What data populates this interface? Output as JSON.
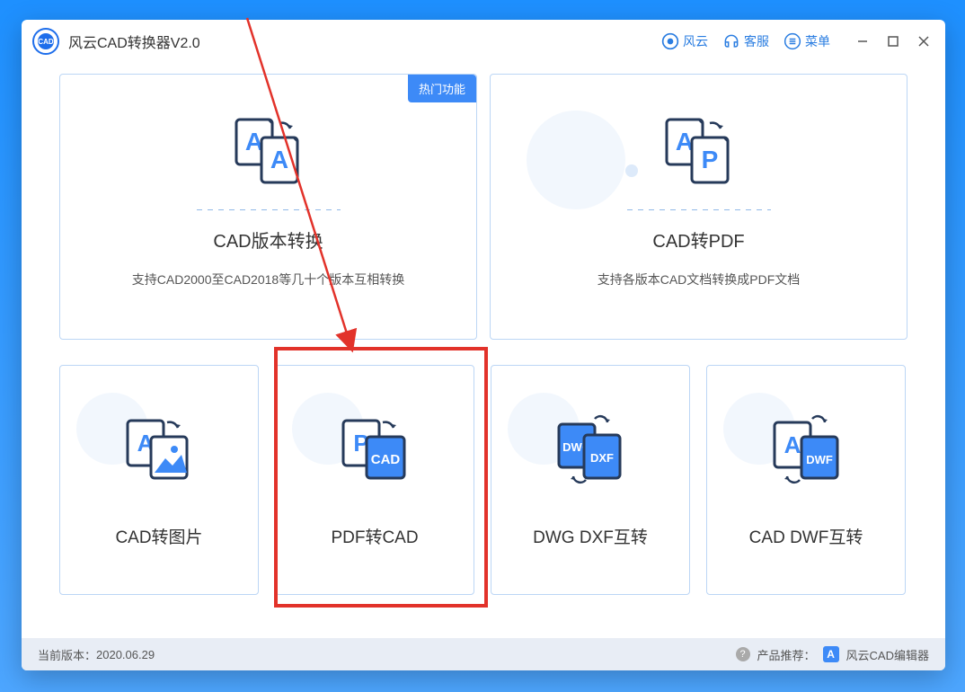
{
  "app": {
    "title": "风云CAD转换器V2.0",
    "logo_text": "CAD"
  },
  "titlebar": {
    "fengyun": "风云",
    "kefu": "客服",
    "menu": "菜单"
  },
  "cards": {
    "cad_version": {
      "badge": "热门功能",
      "title": "CAD版本转换",
      "desc": "支持CAD2000至CAD2018等几十个版本互相转换"
    },
    "cad_pdf": {
      "title": "CAD转PDF",
      "desc": "支持各版本CAD文档转换成PDF文档"
    },
    "cad_image": {
      "title": "CAD转图片"
    },
    "pdf_cad": {
      "title": "PDF转CAD"
    },
    "dwg_dxf": {
      "title": "DWG DXF互转"
    },
    "cad_dwf": {
      "title": "CAD DWF互转"
    }
  },
  "status": {
    "version_label": "当前版本：",
    "version": "2020.06.29",
    "recommend_label": "产品推荐：",
    "recommend_product": "风云CAD编辑器"
  }
}
